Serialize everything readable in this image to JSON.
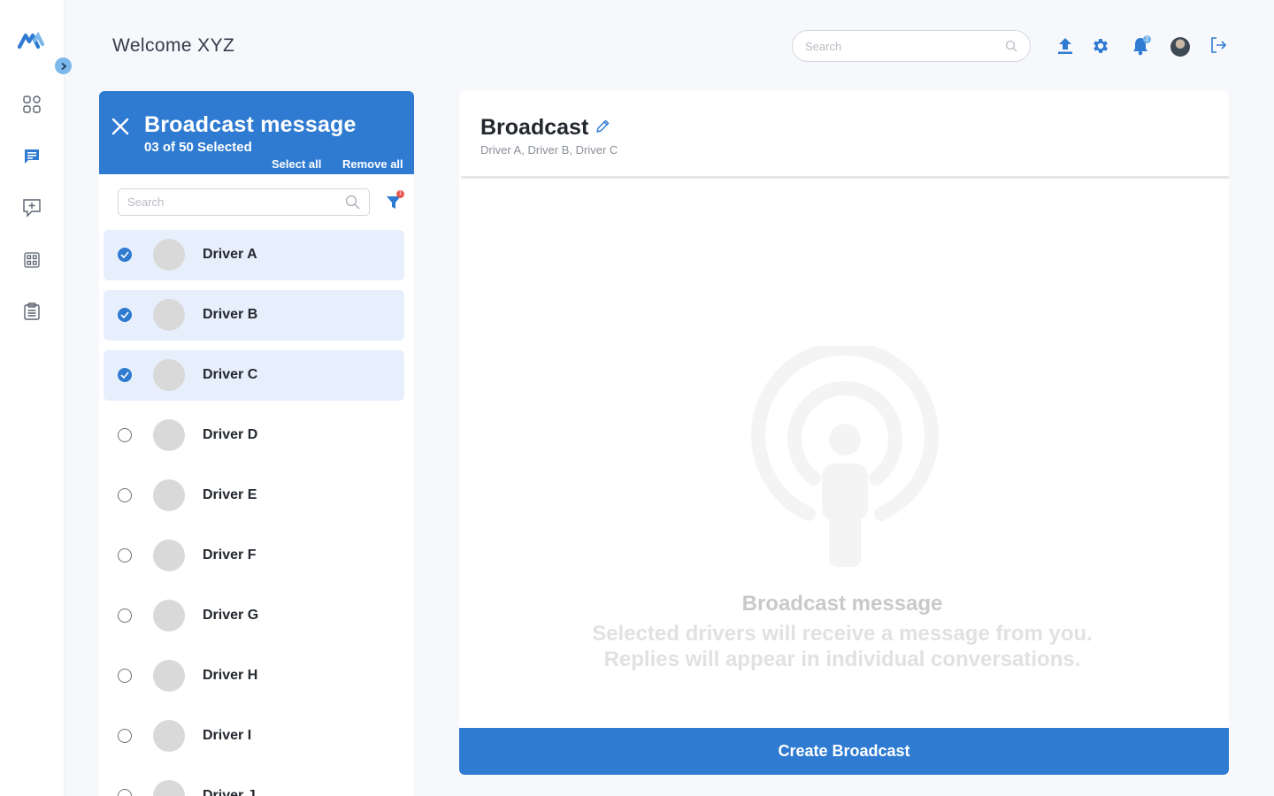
{
  "header": {
    "welcome": "Welcome XYZ",
    "search_placeholder": "Search",
    "notification_count": "2"
  },
  "sidebar": {
    "items": [
      {
        "icon": "dashboard-grid-icon",
        "active": false
      },
      {
        "icon": "chat-icon",
        "active": true
      },
      {
        "icon": "add-chat-icon",
        "active": false
      },
      {
        "icon": "apps-icon",
        "active": false
      },
      {
        "icon": "clipboard-icon",
        "active": false
      }
    ]
  },
  "broadcast_panel": {
    "title": "Broadcast message",
    "selected_text": "03 of 50 Selected",
    "select_all": "Select all",
    "remove_all": "Remove all",
    "search_placeholder": "Search",
    "filter_count": "1",
    "drivers": [
      {
        "name": "Driver A",
        "selected": true
      },
      {
        "name": "Driver B",
        "selected": true
      },
      {
        "name": "Driver C",
        "selected": true
      },
      {
        "name": "Driver D",
        "selected": false
      },
      {
        "name": "Driver E",
        "selected": false
      },
      {
        "name": "Driver F",
        "selected": false
      },
      {
        "name": "Driver G",
        "selected": false
      },
      {
        "name": "Driver H",
        "selected": false
      },
      {
        "name": "Driver I",
        "selected": false
      },
      {
        "name": "Driver J",
        "selected": false
      }
    ]
  },
  "main": {
    "title": "Broadcast",
    "recipients": "Driver A, Driver B, Driver C",
    "empty_title": "Broadcast message",
    "empty_line1": "Selected drivers will receive a message from you.",
    "empty_line2": "Replies will appear in individual conversations.",
    "create_button": "Create Broadcast"
  },
  "colors": {
    "primary": "#2f7bd1",
    "selected_row": "#e7effd",
    "background": "#f7f8fc"
  }
}
